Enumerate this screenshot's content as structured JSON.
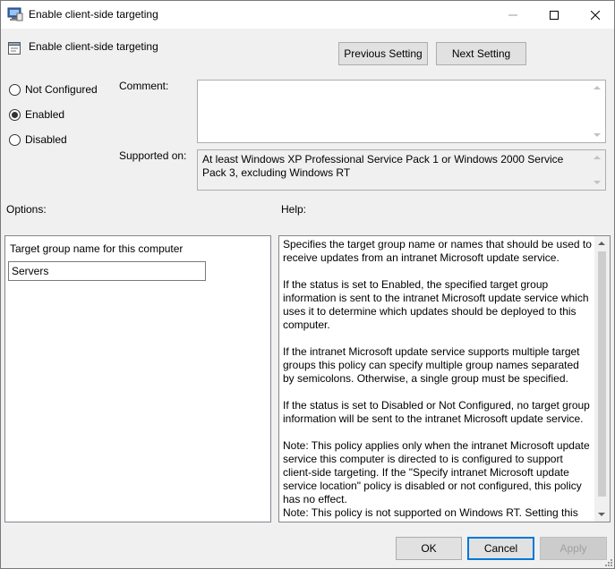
{
  "window": {
    "title": "Enable client-side targeting"
  },
  "header": {
    "title": "Enable client-side targeting",
    "prev_label": "Previous Setting",
    "next_label": "Next Setting"
  },
  "state": {
    "options": [
      {
        "label": "Not Configured",
        "checked": false
      },
      {
        "label": "Enabled",
        "checked": true
      },
      {
        "label": "Disabled",
        "checked": false
      }
    ]
  },
  "comment": {
    "label": "Comment:",
    "value": ""
  },
  "supported": {
    "label": "Supported on:",
    "value": "At least Windows XP Professional Service Pack 1 or Windows 2000 Service Pack 3, excluding Windows RT"
  },
  "options_section": {
    "label": "Options:",
    "field_label": "Target group name for this computer",
    "field_value": "Servers"
  },
  "help_section": {
    "label": "Help:",
    "paragraphs": [
      "Specifies the target group name or names that should be used to receive updates from an intranet Microsoft update service.",
      "If the status is set to Enabled, the specified target group information is sent to the intranet Microsoft update service which uses it to determine which updates should be deployed to this computer.",
      "If the intranet Microsoft update service supports multiple target groups this policy can specify multiple group names separated by semicolons. Otherwise, a single group must be specified.",
      "If the status is set to Disabled or Not Configured, no target group information will be sent to the intranet Microsoft update service.",
      "Note: This policy applies only when the intranet Microsoft update service this computer is directed to is configured to support client-side targeting. If the \"Specify intranet Microsoft update service location\" policy is disabled or not configured, this policy has no effect.",
      "Note: This policy is not supported on Windows RT. Setting this"
    ]
  },
  "footer": {
    "ok_label": "OK",
    "cancel_label": "Cancel",
    "apply_label": "Apply"
  },
  "icons": {
    "title": "policy-app-icon",
    "header": "setting-icon"
  }
}
